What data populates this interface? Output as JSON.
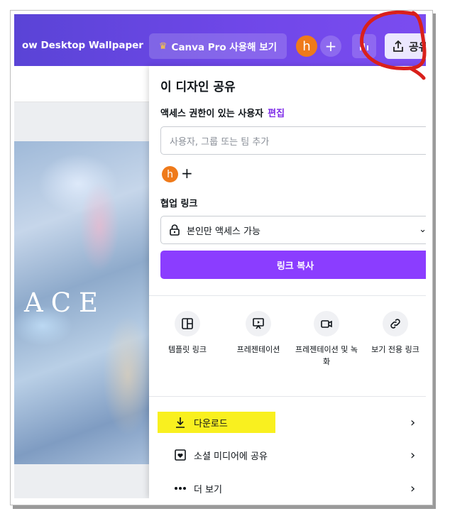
{
  "topbar": {
    "doc_title": "ow Desktop Wallpaper",
    "pro_label": "Canva Pro 사용해 보기",
    "avatar_letter": "h",
    "add": "+",
    "share_label": "공유"
  },
  "canvas": {
    "text": "ACE"
  },
  "panel": {
    "title": "이 디자인 공유",
    "access_label": "액세스 권한이 있는 사용자",
    "edit_link": "편집",
    "add_people_placeholder": "사용자, 그룹 또는 팀 추가",
    "member_avatar": "h",
    "member_add": "+",
    "collab_label": "협업 링크",
    "access_select": "본인만 액세스 가능",
    "copy_link": "링크 복사",
    "options": [
      {
        "label": "템플릿 링크",
        "icon": "template-icon"
      },
      {
        "label": "프레젠테이션",
        "icon": "presentation-icon"
      },
      {
        "label": "프레젠테이션 및 녹화",
        "icon": "record-icon"
      },
      {
        "label": "보기 전용 링크",
        "icon": "link-icon"
      }
    ],
    "menu": [
      {
        "label": "다운로드",
        "icon": "download-icon"
      },
      {
        "label": "소셜 미디어에 공유",
        "icon": "heart-icon"
      },
      {
        "label": "더 보기",
        "icon": "more-icon"
      }
    ]
  },
  "colors": {
    "topbar": "#6f47e8",
    "accent": "#8b3dff",
    "edit_link": "#7d2ae8",
    "avatar": "#ef7a1a",
    "highlight": "#f9f01f",
    "annotation": "#d9201b"
  }
}
